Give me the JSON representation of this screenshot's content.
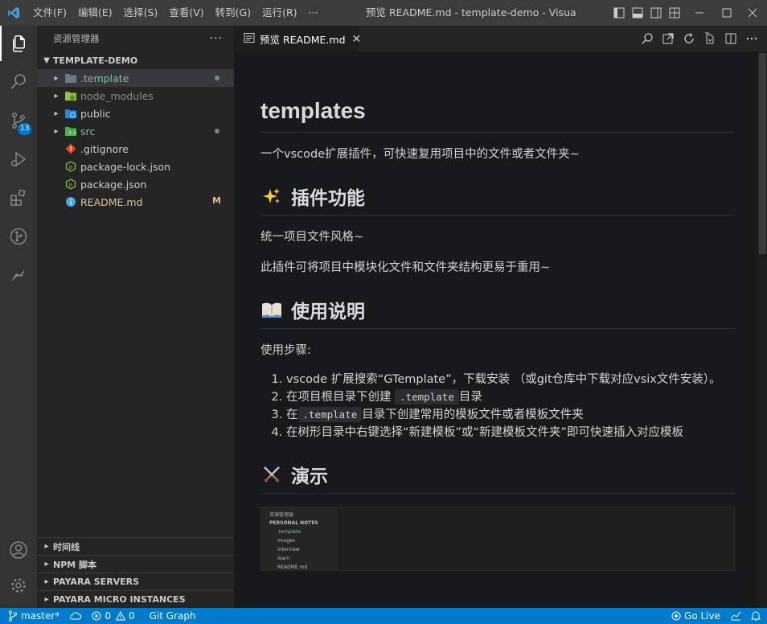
{
  "window": {
    "title": "预览 README.md - template-demo - Visual St..."
  },
  "menu": [
    "文件(F)",
    "编辑(E)",
    "选择(S)",
    "查看(V)",
    "转到(G)",
    "运行(R)",
    "···"
  ],
  "activity_bar": {
    "scm_badge": "13"
  },
  "sidebar": {
    "title": "资源管理器",
    "more": "···",
    "project": "TEMPLATE-DEMO",
    "items": [
      {
        "label": ".template",
        "type": "folder"
      },
      {
        "label": "node_modules",
        "type": "folder"
      },
      {
        "label": "public",
        "type": "folder"
      },
      {
        "label": "src",
        "type": "folder"
      },
      {
        "label": ".gitignore",
        "type": "file"
      },
      {
        "label": "package-lock.json",
        "type": "file"
      },
      {
        "label": "package.json",
        "type": "file"
      },
      {
        "label": "README.md",
        "type": "file",
        "status": "M"
      }
    ],
    "bottom_sections": [
      "时间线",
      "NPM 脚本",
      "PAYARA SERVERS",
      "PAYARA MICRO INSTANCES"
    ]
  },
  "editor": {
    "tab_label": "预览 README.md",
    "tab_close": "✕"
  },
  "markdown": {
    "h1": "templates",
    "intro": "一个vscode扩展插件，可快速复用项目中的文件或者文件夹~",
    "h2_features": "插件功能",
    "features_p1": "统一项目文件风格~",
    "features_p2": "此插件可将项目中模块化文件和文件夹结构更易于重用~",
    "h2_usage": "使用说明",
    "usage_intro": "使用步骤:",
    "steps": {
      "s1": "vscode 扩展搜索“GTemplate”，下载安装 （或git仓库中下载对应vsix文件安装）。",
      "s2_pre": "在项目根目录下创建",
      "s2_code": ".template",
      "s2_post": "目录",
      "s3_pre": "在",
      "s3_code": ".template",
      "s3_post": "目录下创建常用的模板文件或者模板文件夹",
      "s4": "在树形目录中右键选择“新建模板”或“新建模板文件夹”即可快速插入对应模板"
    },
    "h2_demo": "演示",
    "gif": {
      "header": "资源管理器",
      "section": "PERSONAL NOTES",
      "rows": [
        ".template",
        "images",
        "interview",
        "learn",
        "README.md"
      ]
    }
  },
  "statusbar": {
    "branch": "master*",
    "errors": "0",
    "warnings": "0",
    "git_graph": "Git Graph",
    "go_live": "Go Live"
  },
  "colors": {
    "accent": "#007acc",
    "git_untracked": "#73c991",
    "git_modified": "#e2c08d"
  }
}
